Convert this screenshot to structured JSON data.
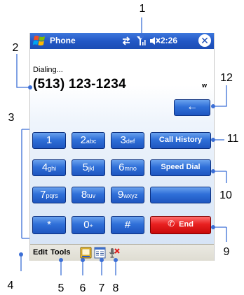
{
  "title_bar": {
    "app_name": "Phone",
    "time": "2:26",
    "close_symbol": "✕"
  },
  "dialer": {
    "status": "Dialing...",
    "number": "(513) 123-1234",
    "indicator": "w"
  },
  "keypad": {
    "keys": [
      {
        "digit": "1",
        "letters": ""
      },
      {
        "digit": "2",
        "letters": "abc"
      },
      {
        "digit": "3",
        "letters": "def"
      },
      {
        "digit": "4",
        "letters": "ghi"
      },
      {
        "digit": "5",
        "letters": "jkl"
      },
      {
        "digit": "6",
        "letters": "mno"
      },
      {
        "digit": "7",
        "letters": "pqrs"
      },
      {
        "digit": "8",
        "letters": "tuv"
      },
      {
        "digit": "9",
        "letters": "wxyz"
      },
      {
        "digit": "*",
        "letters": ""
      },
      {
        "digit": "0",
        "letters": "+"
      },
      {
        "digit": "#",
        "letters": ""
      }
    ]
  },
  "side_buttons": {
    "backspace": "←",
    "call_history": "Call History",
    "speed_dial": "Speed Dial",
    "blank": "",
    "end": "End"
  },
  "menu_bar": {
    "edit": "Edit",
    "tools": "Tools"
  },
  "icons": {
    "start": "windows-flag-icon",
    "connectivity": "connectivity-icon",
    "signal": "signal-strength-icon",
    "volume": "volume-muted-icon",
    "contacts": "contacts-icon",
    "notes": "notes-icon",
    "mute": "microphone-mute-icon"
  },
  "colors": {
    "title_bar": "#2358c6",
    "key_blue": "#2f6fd8",
    "end_red": "#e82020",
    "callout_blue": "#3c6fd6"
  },
  "callouts": [
    "1",
    "2",
    "3",
    "4",
    "5",
    "6",
    "7",
    "8",
    "9",
    "10",
    "11",
    "12"
  ]
}
